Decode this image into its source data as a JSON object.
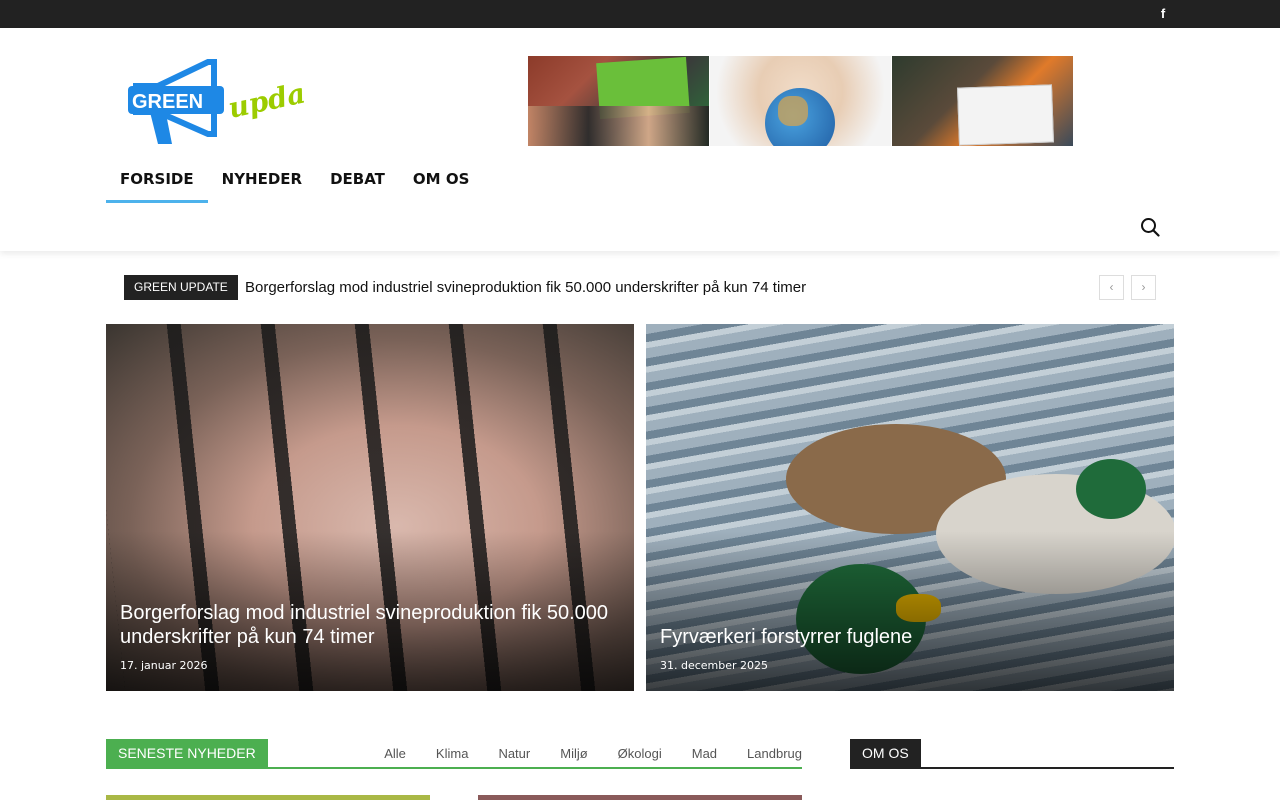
{
  "topbar": {
    "social_icon": "facebook-icon"
  },
  "logo": {
    "text_main": "GREEN",
    "text_script": "update",
    "accent": "#1e88e5",
    "accent2": "#9ccc00"
  },
  "nav": {
    "items": [
      "FORSIDE",
      "NYHEDER",
      "DEBAT",
      "OM OS"
    ],
    "active": "FORSIDE",
    "accent": "#4db2ec"
  },
  "search": {
    "icon": "search-icon"
  },
  "ticker": {
    "tag": "GREEN UPDATE",
    "headline": "Borgerforslag mod industriel svineproduktion fik 50.000 underskrifter på kun 74 timer",
    "prev": "‹",
    "next": "›"
  },
  "features": [
    {
      "title": "Borgerforslag mod industriel svineproduktion fik 50.000 underskrifter på kun 74 timer",
      "date": "17. januar 2026"
    },
    {
      "title": "Fyrværkeri forstyrrer fuglene",
      "date": "31. december 2025"
    }
  ],
  "latest": {
    "tag": "SENESTE NYHEDER",
    "filters": [
      "Alle",
      "Klima",
      "Natur",
      "Miljø",
      "Økologi",
      "Mad",
      "Landbrug"
    ],
    "accent": "#4caf50"
  },
  "about": {
    "tag": "OM OS"
  }
}
